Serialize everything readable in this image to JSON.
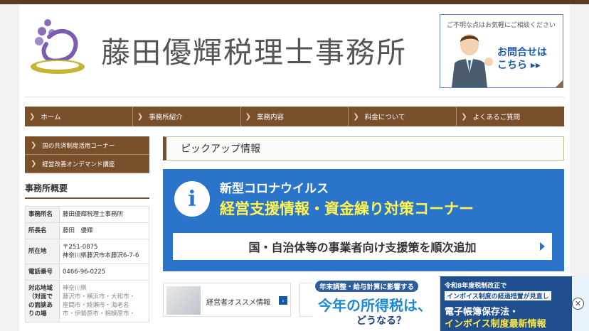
{
  "header": {
    "site_title": "藤田優輝税理士事務所",
    "contact_note": "ご不明な点はお気軽にご相談ください",
    "contact_cta_line1": "お問合せは",
    "contact_cta_line2": "こちら ▸▸"
  },
  "nav": {
    "items": [
      {
        "label": "ホーム"
      },
      {
        "label": "事務所紹介"
      },
      {
        "label": "業務内容"
      },
      {
        "label": "料金について"
      },
      {
        "label": "よくあるご質問"
      }
    ]
  },
  "sidebar": {
    "buttons": [
      {
        "label": "国の共済制度活用コーナー"
      },
      {
        "label": "経営改善オンデマンド講座"
      }
    ],
    "heading": "事務所概要",
    "table": [
      {
        "key": "事務所名",
        "value": "藤田優輝税理士事務所"
      },
      {
        "key": "所長名",
        "value": "藤田　優輝"
      },
      {
        "key": "所在地",
        "value": "〒251-0875",
        "value2": "神奈川県藤沢市本藤沢6-7-6"
      },
      {
        "key": "電話番号",
        "value": "0466-96-0225"
      },
      {
        "key": "対応地域",
        "key2": "（対面で",
        "key3": "の面談あ",
        "key4": "りの場",
        "value": "神奈川県",
        "value2": "藤沢市・横浜市・大和市・",
        "value3": "座間市・綾瀬市・海老名",
        "value4": "市・伊勢原市・相模原市・"
      }
    ]
  },
  "main": {
    "pickup_title": "ピックアップ情報",
    "banner": {
      "icon": "i",
      "line1": "新型コロナウイルス",
      "line2": "経営支援情報・資金繰り対策コーナー",
      "bar_text": "国・自治体等の事業者向け支援策を順次追加"
    },
    "cards": [
      {
        "label": "経営者オススメ情報"
      }
    ]
  },
  "promo": {
    "left_top": "年末調整・給与計算に影響する",
    "left_big": "今年の所得税は、",
    "left_small": "どうなる？",
    "right_l1": "令和8年度税制改正で",
    "right_l2": "インボイス制度の経過措置が見直し",
    "right_l3": "電子帳簿保存法・",
    "right_l4": "インボイス制度最新情報",
    "close": "✕"
  },
  "colors": {
    "brown": "#7a4f2c",
    "blue": "#2a74c9",
    "yellow": "#fff44f"
  }
}
